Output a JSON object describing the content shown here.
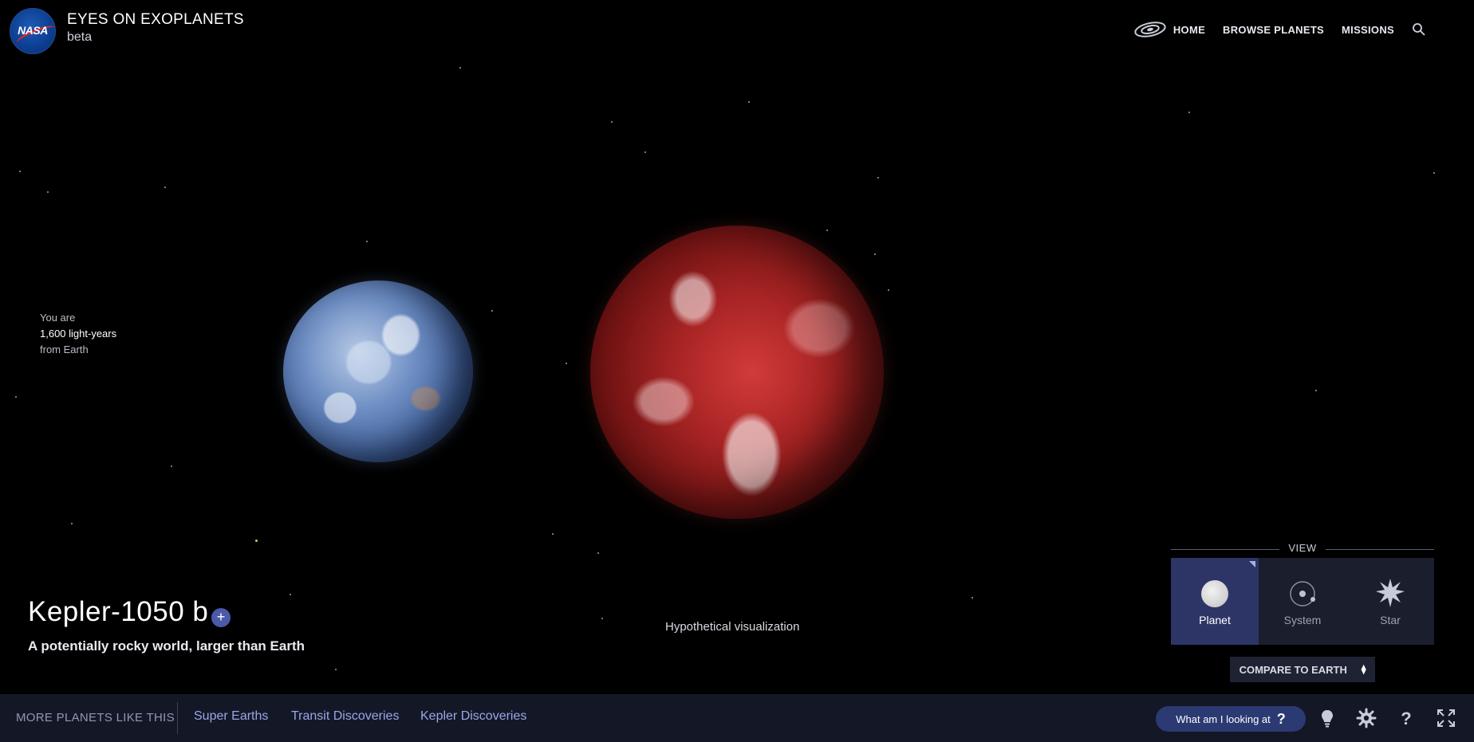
{
  "header": {
    "logo_text": "NASA",
    "app_title": "EYES ON EXOPLANETS",
    "app_subtitle": "beta",
    "nav": [
      {
        "label": "HOME",
        "icon": "galaxy-icon"
      },
      {
        "label": "BROWSE PLANETS"
      },
      {
        "label": "MISSIONS"
      }
    ],
    "search_icon": "search-icon"
  },
  "distance": {
    "line1": "You are",
    "line2": "1,600 light-years",
    "line3": "from Earth"
  },
  "scene": {
    "caption": "Hypothetical visualization"
  },
  "planet": {
    "name": "Kepler-1050 b",
    "add_label": "+",
    "description": "A potentially rocky world, larger than Earth"
  },
  "view": {
    "label": "VIEW",
    "options": [
      {
        "label": "Planet",
        "icon": "planet-icon",
        "active": true
      },
      {
        "label": "System",
        "icon": "system-icon",
        "active": false
      },
      {
        "label": "Star",
        "icon": "star-icon",
        "active": false
      }
    ],
    "compare_label": "COMPARE TO EARTH"
  },
  "bottom_bar": {
    "more_label": "MORE PLANETS LIKE THIS",
    "categories": [
      "Super Earths",
      "Transit Discoveries",
      "Kepler Discoveries"
    ],
    "looking_label": "What am I looking at",
    "looking_icon": "?",
    "icons": [
      "lightbulb-icon",
      "settings-icon",
      "help-icon",
      "fullscreen-icon"
    ]
  },
  "colors": {
    "background": "#000000",
    "bottom_bar": "#141826",
    "accent": "#2c3a73",
    "active_view": "#2d3566",
    "link": "#9aa6e8"
  }
}
